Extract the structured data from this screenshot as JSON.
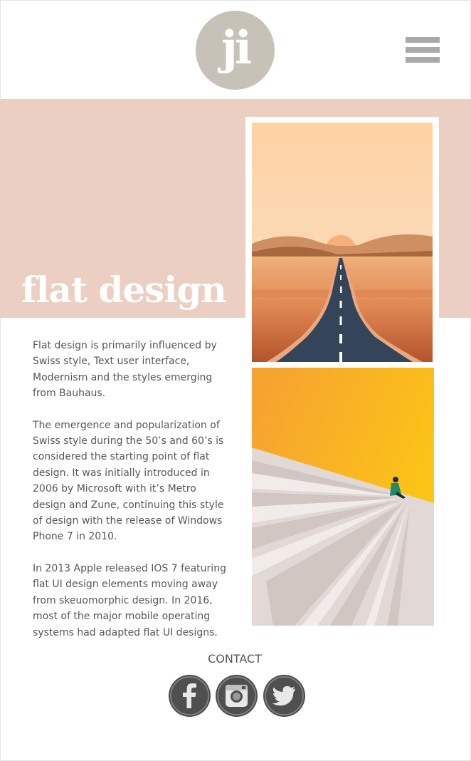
{
  "header": {
    "logo_text": "ji",
    "menu_icon": "hamburger-icon"
  },
  "hero": {
    "title": "flat design"
  },
  "images": [
    {
      "subject": "desert road at sunset"
    },
    {
      "subject": "figure sitting on white stairs against orange sky"
    }
  ],
  "article": {
    "paragraphs": [
      "Flat design is primarily influenced by Swiss style, Text user interface, Modernism and the styles emerging from Bauhaus.",
      "The emergence and popularization of Swiss style during the 50’s and 60’s is considered the starting point of flat design. It was initially introduced in 2006 by Microsoft with it’s Metro design and Zune, continuing this style of design with the release of Windows Phone 7 in 2010.",
      "In 2013 Apple released IOS 7 featuring flat UI design elements moving away from skeuomorphic design. In 2016, most of the major mobile operating systems had adapted flat UI designs."
    ]
  },
  "footer": {
    "contact_label": "CONTACT",
    "social": [
      {
        "icon": "facebook-icon"
      },
      {
        "icon": "instagram-icon"
      },
      {
        "icon": "twitter-icon"
      }
    ]
  },
  "colors": {
    "band": "#ebcfc3",
    "logo_bg": "#c6c2b8",
    "social_bg": "#4f4f4f",
    "menu_bars": "#a9a9a9"
  }
}
